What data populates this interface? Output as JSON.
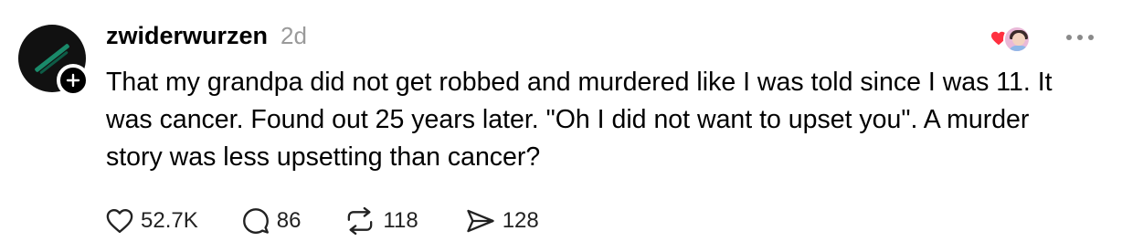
{
  "post": {
    "username": "zwiderwurzen",
    "timestamp": "2d",
    "text": "That my grandpa did not get robbed and murdered like I was told since I was 11. It was cancer. Found out 25 years later. \"Oh I did not want to upset you\". A murder story was less upsetting than cancer?",
    "avatar_icon": "profile-avatar",
    "follow_icon": "plus-icon",
    "more_icon": "more-icon"
  },
  "reactions": {
    "heart_color": "#ff3040",
    "icon": "heart-icon"
  },
  "actions": {
    "likes": {
      "icon": "heart-outline-icon",
      "count": "52.7K"
    },
    "replies": {
      "icon": "comment-icon",
      "count": "86"
    },
    "reposts": {
      "icon": "repost-icon",
      "count": "118"
    },
    "shares": {
      "icon": "send-icon",
      "count": "128"
    }
  }
}
